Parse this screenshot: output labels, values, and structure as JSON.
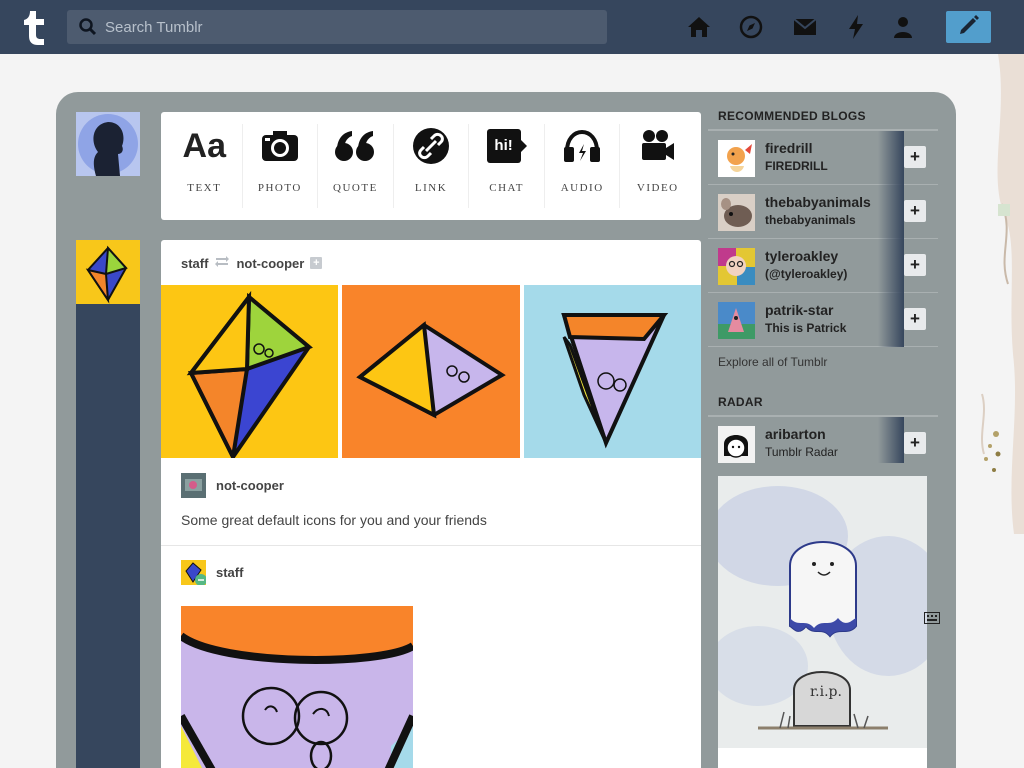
{
  "search": {
    "placeholder": "Search Tumblr"
  },
  "nav": {
    "icons": [
      "home-icon",
      "explore-icon",
      "inbox-icon",
      "activity-icon",
      "account-icon"
    ],
    "compose_icon": "pencil-icon"
  },
  "post_types": [
    {
      "label": "TEXT",
      "icon": "Aa"
    },
    {
      "label": "PHOTO",
      "icon": "camera-icon"
    },
    {
      "label": "QUOTE",
      "icon": "quote-icon"
    },
    {
      "label": "LINK",
      "icon": "link-icon"
    },
    {
      "label": "CHAT",
      "icon": "hi!"
    },
    {
      "label": "AUDIO",
      "icon": "headphones-icon"
    },
    {
      "label": "VIDEO",
      "icon": "video-camera-icon"
    }
  ],
  "post": {
    "reblogger": "staff",
    "original_author": "not-cooper",
    "source_name": "not-cooper",
    "caption": "Some great default icons for you and your friends",
    "reblog_by": "staff"
  },
  "sidebar": {
    "recommended_title": "RECOMMENDED BLOGS",
    "blogs": [
      {
        "name": "firedrill",
        "subtitle": "FIREDRILL",
        "color": "#e9a45a"
      },
      {
        "name": "thebabyanimals",
        "subtitle": "thebabyanimals",
        "color": "#8a7b6f"
      },
      {
        "name": "tyleroakley",
        "subtitle": "(@tyleroakley)",
        "color": "#c03a8c"
      },
      {
        "name": "patrik-star",
        "subtitle": "This is Patrick",
        "color": "#4a8ac9"
      }
    ],
    "explore_text": "Explore all of Tumblr",
    "radar_title": "RADAR",
    "radar": {
      "name": "aribarton",
      "subtitle": "Tumblr Radar"
    }
  },
  "colors": {
    "topbar": "#36465d",
    "compose": "#529ecc",
    "frame": "#919a9b"
  }
}
